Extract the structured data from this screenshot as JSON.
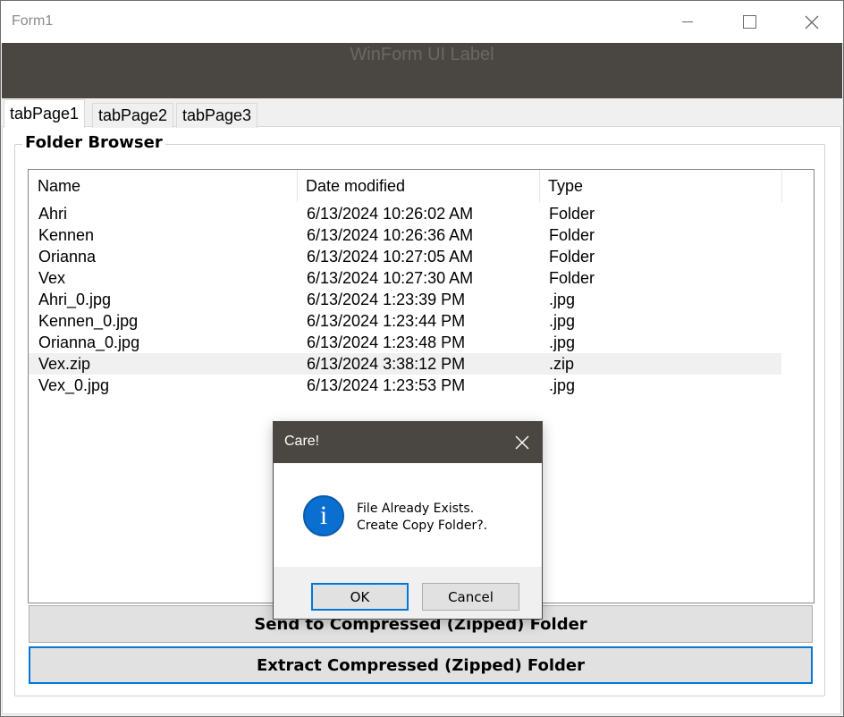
{
  "window": {
    "title": "Form1"
  },
  "banner": {
    "label": "WinForm UI Label"
  },
  "tabs": [
    {
      "label": "tabPage1",
      "active": true
    },
    {
      "label": "tabPage2",
      "active": false
    },
    {
      "label": "tabPage3",
      "active": false
    }
  ],
  "folder_browser": {
    "title": "Folder Browser",
    "columns": [
      "Name",
      "Date modified",
      "Type"
    ],
    "rows": [
      {
        "name": "Ahri",
        "date": "6/13/2024 10:26:02 AM",
        "type": "Folder"
      },
      {
        "name": "Kennen",
        "date": "6/13/2024 10:26:36 AM",
        "type": "Folder"
      },
      {
        "name": "Orianna",
        "date": "6/13/2024 10:27:05 AM",
        "type": "Folder"
      },
      {
        "name": "Vex",
        "date": "6/13/2024 10:27:30 AM",
        "type": "Folder"
      },
      {
        "name": "Ahri_0.jpg",
        "date": "6/13/2024 1:23:39 PM",
        "type": ".jpg"
      },
      {
        "name": "Kennen_0.jpg",
        "date": "6/13/2024 1:23:44 PM",
        "type": ".jpg"
      },
      {
        "name": "Orianna_0.jpg",
        "date": "6/13/2024 1:23:48 PM",
        "type": ".jpg"
      },
      {
        "name": "Vex.zip",
        "date": "6/13/2024 3:38:12 PM",
        "type": ".zip"
      },
      {
        "name": "Vex_0.jpg",
        "date": "6/13/2024 1:23:53 PM",
        "type": ".jpg"
      }
    ],
    "selected_row": "Vex.zip"
  },
  "buttons": {
    "compress": "Send to Compressed (Zipped) Folder",
    "extract": "Extract Compressed (Zipped) Folder"
  },
  "dialog": {
    "title": "Care!",
    "message_line1": "File Already Exists.",
    "message_line2": "Create Copy Folder?.",
    "ok_label": "OK",
    "cancel_label": "Cancel",
    "icon": "info-icon"
  },
  "colors": {
    "banner_bg": "#4a4642",
    "accent": "#0078d7",
    "info_icon": "#0a6fd0"
  }
}
